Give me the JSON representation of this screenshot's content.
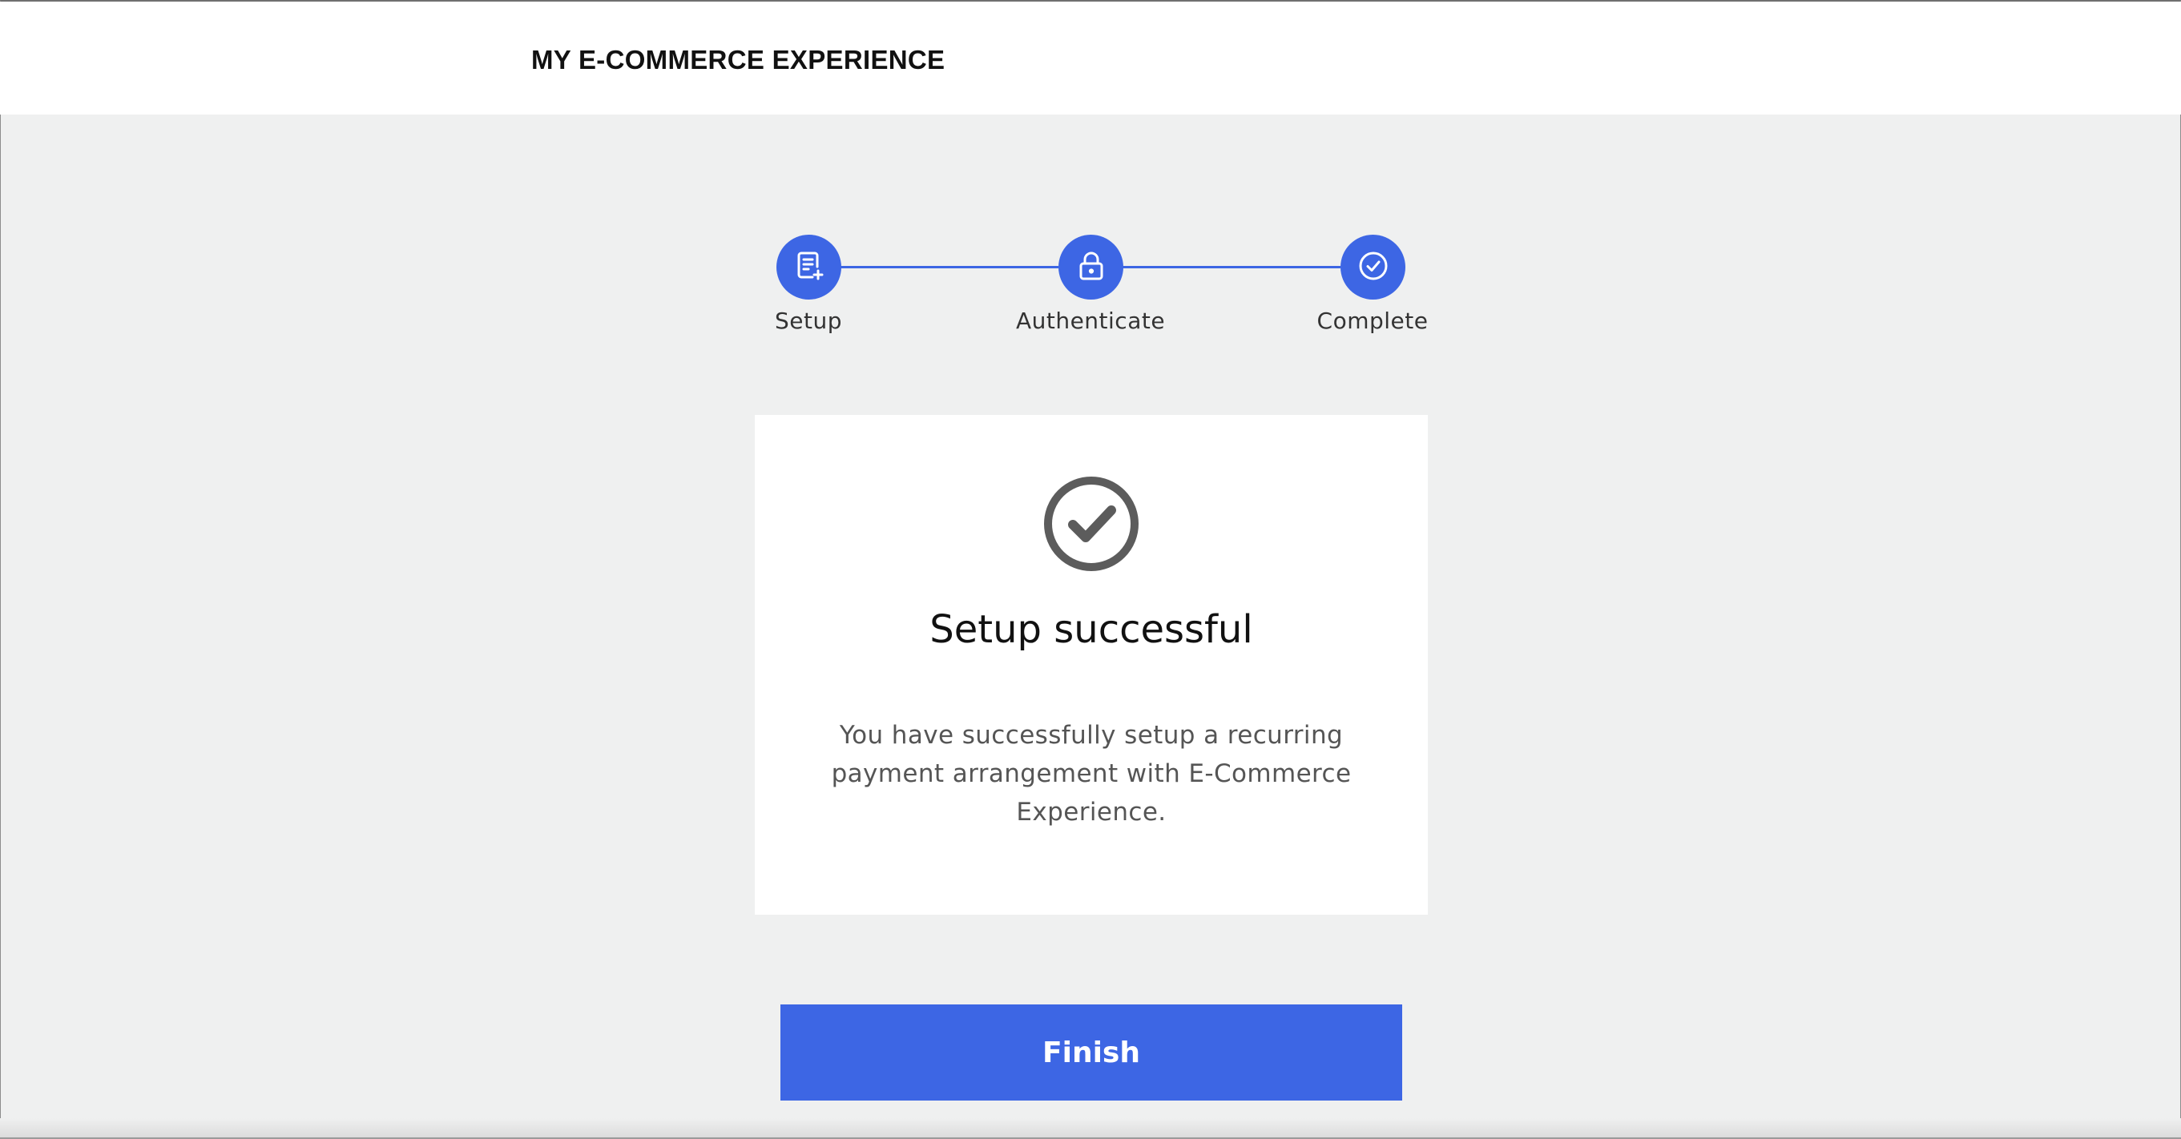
{
  "header": {
    "brand": "MY E-COMMERCE EXPERIENCE"
  },
  "stepper": {
    "accent_color": "#3d66e4",
    "steps": [
      {
        "label": "Setup",
        "icon": "document-add-icon",
        "status": "complete"
      },
      {
        "label": "Authenticate",
        "icon": "lock-icon",
        "status": "complete"
      },
      {
        "label": "Complete",
        "icon": "check-circle-icon",
        "status": "current"
      }
    ]
  },
  "result": {
    "icon": "success-check-icon",
    "title": "Setup successful",
    "message": "You have successfully setup a recurring payment arrangement with E-Commerce Experience."
  },
  "actions": {
    "finish_label": "Finish"
  }
}
